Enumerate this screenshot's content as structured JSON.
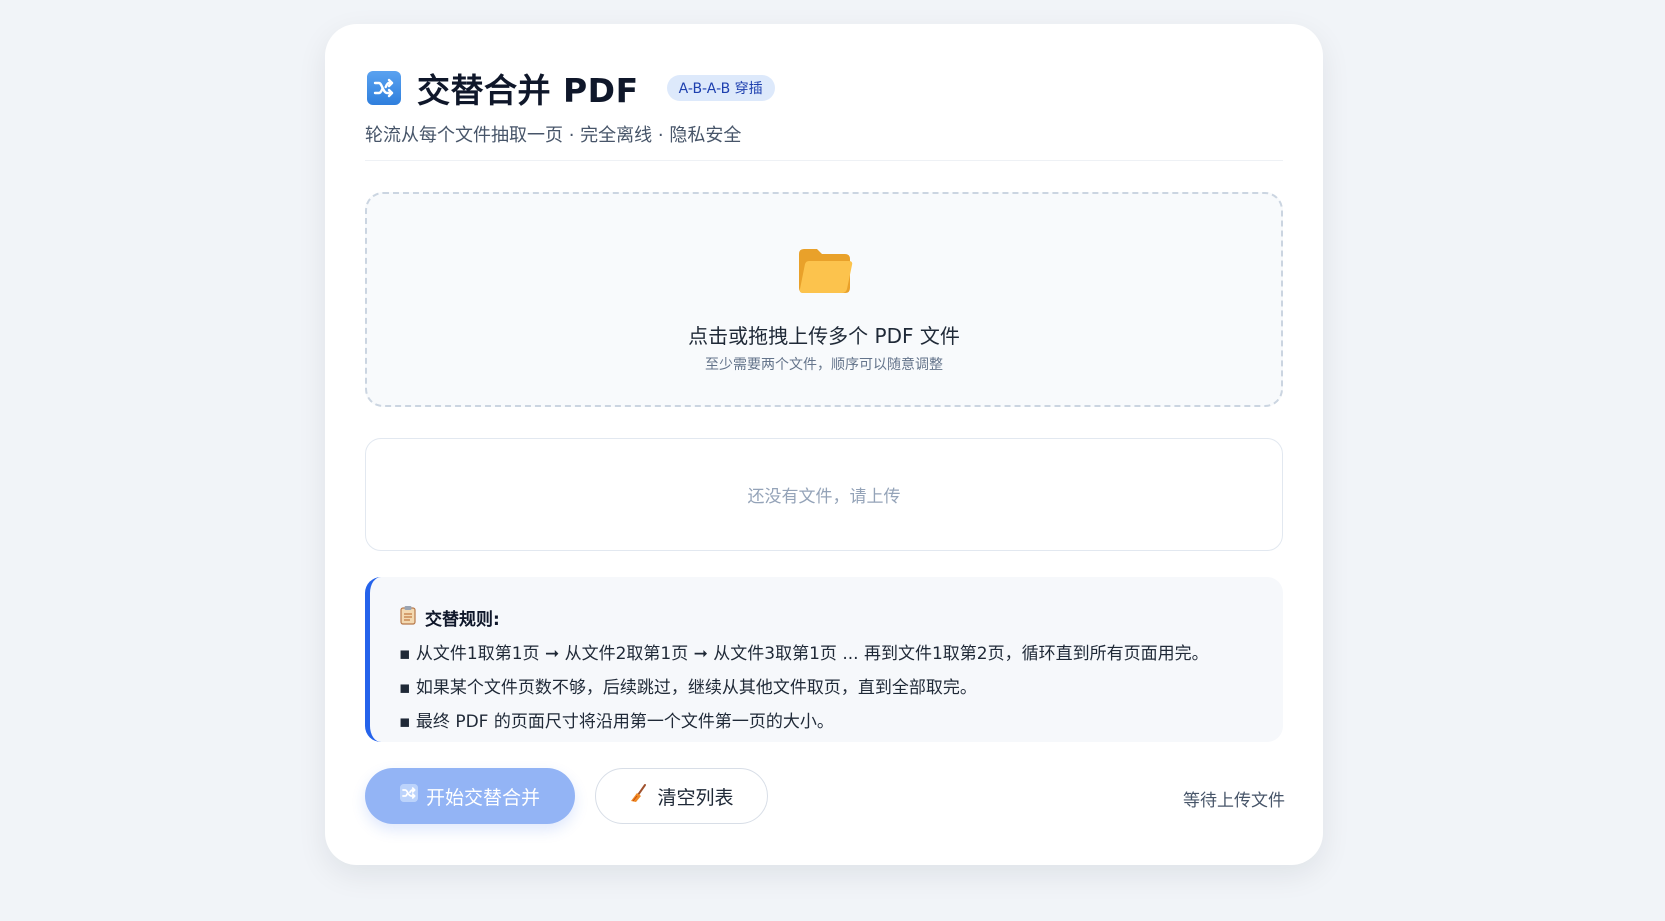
{
  "header": {
    "title": "交替合并 PDF",
    "badge": "A-B-A-B 穿插",
    "subtitle": "轮流从每个文件抽取一页 · 完全离线 · 隐私安全"
  },
  "dropzone": {
    "title": "点击或拖拽上传多个 PDF 文件",
    "hint": "至少需要两个文件，顺序可以随意调整"
  },
  "file_list": {
    "empty_text": "还没有文件，请上传"
  },
  "rules": {
    "heading": "交替规则:",
    "lines": [
      "▪ 从文件1取第1页 ➞ 从文件2取第1页 ➞ 从文件3取第1页 ... 再到文件1取第2页，循环直到所有页面用完。",
      "▪ 如果某个文件页数不够，后续跳过，继续从其他文件取页，直到全部取完。",
      "▪ 最终 PDF 的页面尺寸将沿用第一个文件第一页的大小。"
    ]
  },
  "actions": {
    "start_label": "开始交替合并",
    "clear_label": "清空列表",
    "status": "等待上传文件"
  },
  "icons": {
    "title": "shuffle-icon",
    "folder": "folder-icon",
    "rules": "clipboard-icon",
    "start": "shuffle-icon",
    "clear": "broom-icon"
  },
  "colors": {
    "accent": "#2563eb",
    "primary_button": "#93b4f5",
    "folder": "#f9b233"
  }
}
